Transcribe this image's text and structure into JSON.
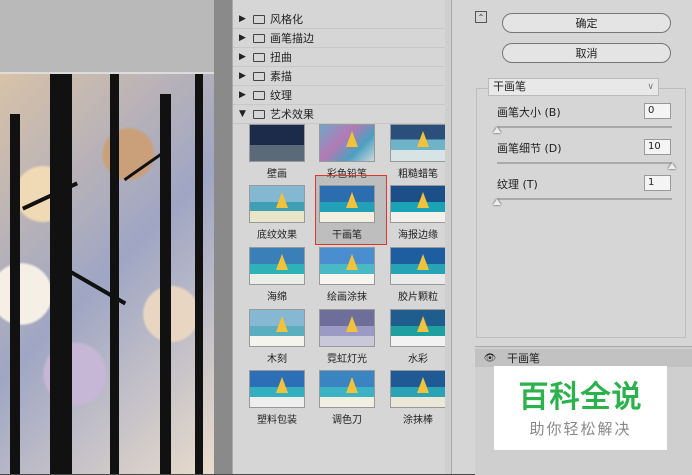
{
  "categories": [
    {
      "label": "风格化",
      "expanded": false
    },
    {
      "label": "画笔描边",
      "expanded": false
    },
    {
      "label": "扭曲",
      "expanded": false
    },
    {
      "label": "素描",
      "expanded": false
    },
    {
      "label": "纹理",
      "expanded": false
    },
    {
      "label": "艺术效果",
      "expanded": true
    }
  ],
  "filters": [
    {
      "label": "壁画"
    },
    {
      "label": "彩色铅笔"
    },
    {
      "label": "粗糙蜡笔"
    },
    {
      "label": "底纹效果"
    },
    {
      "label": "干画笔",
      "selected": true
    },
    {
      "label": "海报边缘"
    },
    {
      "label": "海绵"
    },
    {
      "label": "绘画涂抹"
    },
    {
      "label": "胶片颗粒"
    },
    {
      "label": "木刻"
    },
    {
      "label": "霓虹灯光"
    },
    {
      "label": "水彩"
    },
    {
      "label": "塑料包装"
    },
    {
      "label": "调色刀"
    },
    {
      "label": "涂抹棒"
    }
  ],
  "buttons": {
    "ok": "确定",
    "cancel": "取消"
  },
  "current_filter": "干画笔",
  "params": [
    {
      "label": "画笔大小 (B)",
      "value": "0",
      "level": 0.0
    },
    {
      "label": "画笔细节 (D)",
      "value": "10",
      "level": 1.0
    },
    {
      "label": "纹理 (T)",
      "value": "1",
      "level": 0.0
    }
  ],
  "layer": {
    "name": "干画笔"
  },
  "watermark": {
    "title": "百科全说",
    "subtitle": "助你轻松解决"
  }
}
